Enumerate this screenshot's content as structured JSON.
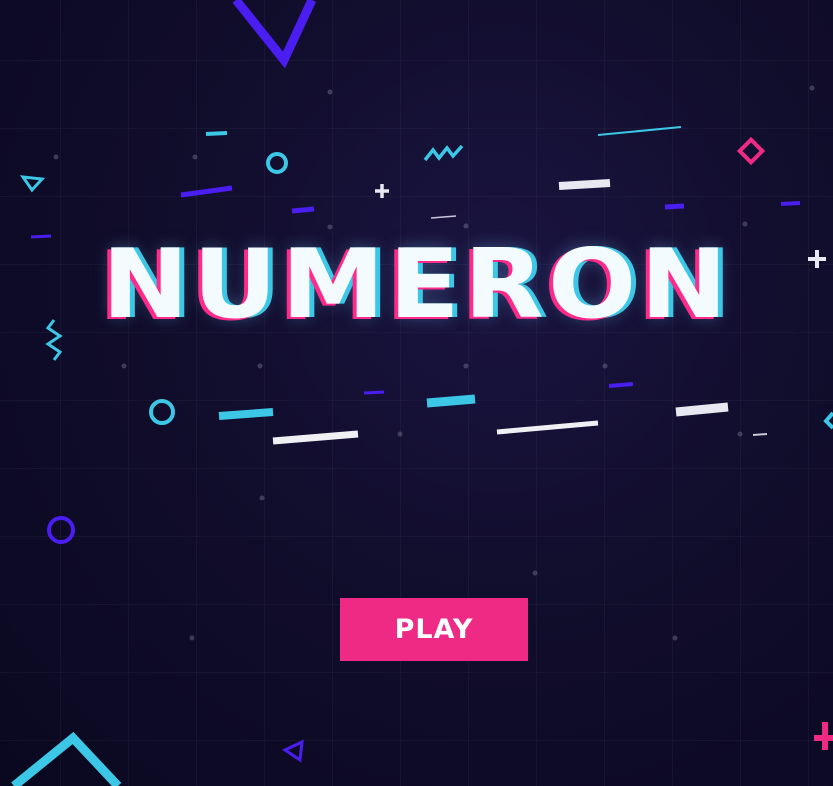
{
  "game": {
    "title": "NUMERON",
    "play_label": "PLAY"
  },
  "colors": {
    "background": "#0e0b24",
    "accent_pink": "#ee2a84",
    "accent_cyan": "#3cc7e6",
    "accent_purple": "#4a1df0",
    "text_white": "#f4fbff"
  },
  "decorations": [
    "triangle-icon",
    "circle-icon",
    "zigzag-icon",
    "plus-icon",
    "diamond-icon",
    "dash-line"
  ]
}
